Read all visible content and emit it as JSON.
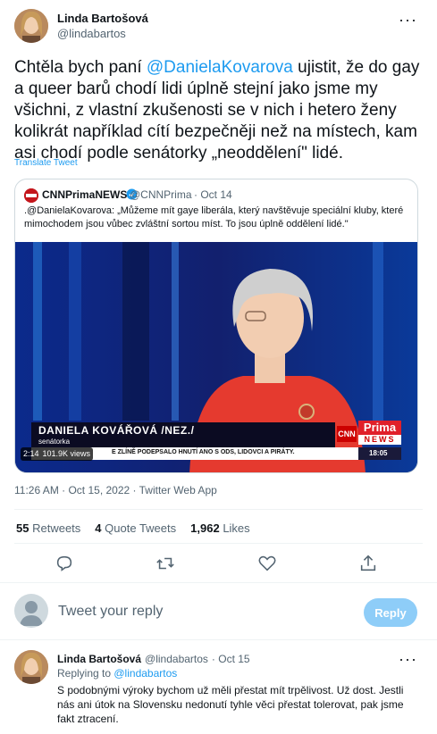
{
  "main_tweet": {
    "author_name": "Linda Bartošová",
    "handle": "@lindabartos",
    "text_prefix": "Chtěla bych paní ",
    "mention": "@DanielaKovarova",
    "text_rest": " ujistit, že do gay a queer barů chodí lidi úplně stejní jako jsme my všichni, z vlastní zkušenosti se v nich i hetero ženy kolikrát například cítí bezpečněji než na místech, kam asi chodí podle senátorky „neoddělení\" lidé.",
    "translate": "Translate Tweet",
    "timestamp": "11:26 AM · Oct 15, 2022 · Twitter Web App"
  },
  "quoted_tweet": {
    "author_name": "CNNPrimaNEWS",
    "handle": "@CNNPrima",
    "date": "· Oct 14",
    "text": ".@DanielaKovarova: „Můžeme mít gaye liberála, který navštěvuje speciální kluby, které mimochodem jsou vůbec zvláštní sortou míst. To jsou úplně oddělení lidé.\"",
    "video": {
      "lower_third_name": "DANIELA KOVÁŘOVÁ /NEZ./",
      "lower_third_role": "senátorka",
      "ticker": "E ZLÍNĚ PODEPSALO HNUTÍ ANO S ODS, LIDOVCI A PIRÁTY.",
      "clock": "18:05",
      "duration": "2:14",
      "views": "101.9K views",
      "logo_cnn": "CNN",
      "logo_prima": "Prima",
      "logo_news": "NEWS"
    }
  },
  "stats": {
    "retweets_count": "55",
    "retweets_label": "Retweets",
    "quotes_count": "4",
    "quotes_label": "Quote Tweets",
    "likes_count": "1,962",
    "likes_label": "Likes"
  },
  "composer": {
    "placeholder": "Tweet your reply",
    "reply_button": "Reply"
  },
  "reply_tweet": {
    "author_name": "Linda Bartošová",
    "handle": "@lindabartos",
    "date": "· Oct 15",
    "replying_prefix": "Replying to ",
    "replying_to": "@lindabartos",
    "text": "S podobnými výroky bychom už měli přestat mít trpělivost. Už dost. Jestli nás ani útok na Slovensku nedonutí tyhle věci přestat tolerovat, pak jsme fakt ztracení."
  },
  "icons": [
    "more-icon",
    "reply-icon",
    "retweet-icon",
    "like-icon",
    "share-icon",
    "verified-badge-icon"
  ],
  "colors": {
    "accent": "#1d9bf0",
    "muted": "#536471",
    "border": "#cfd9de",
    "red": "#e0202a"
  }
}
